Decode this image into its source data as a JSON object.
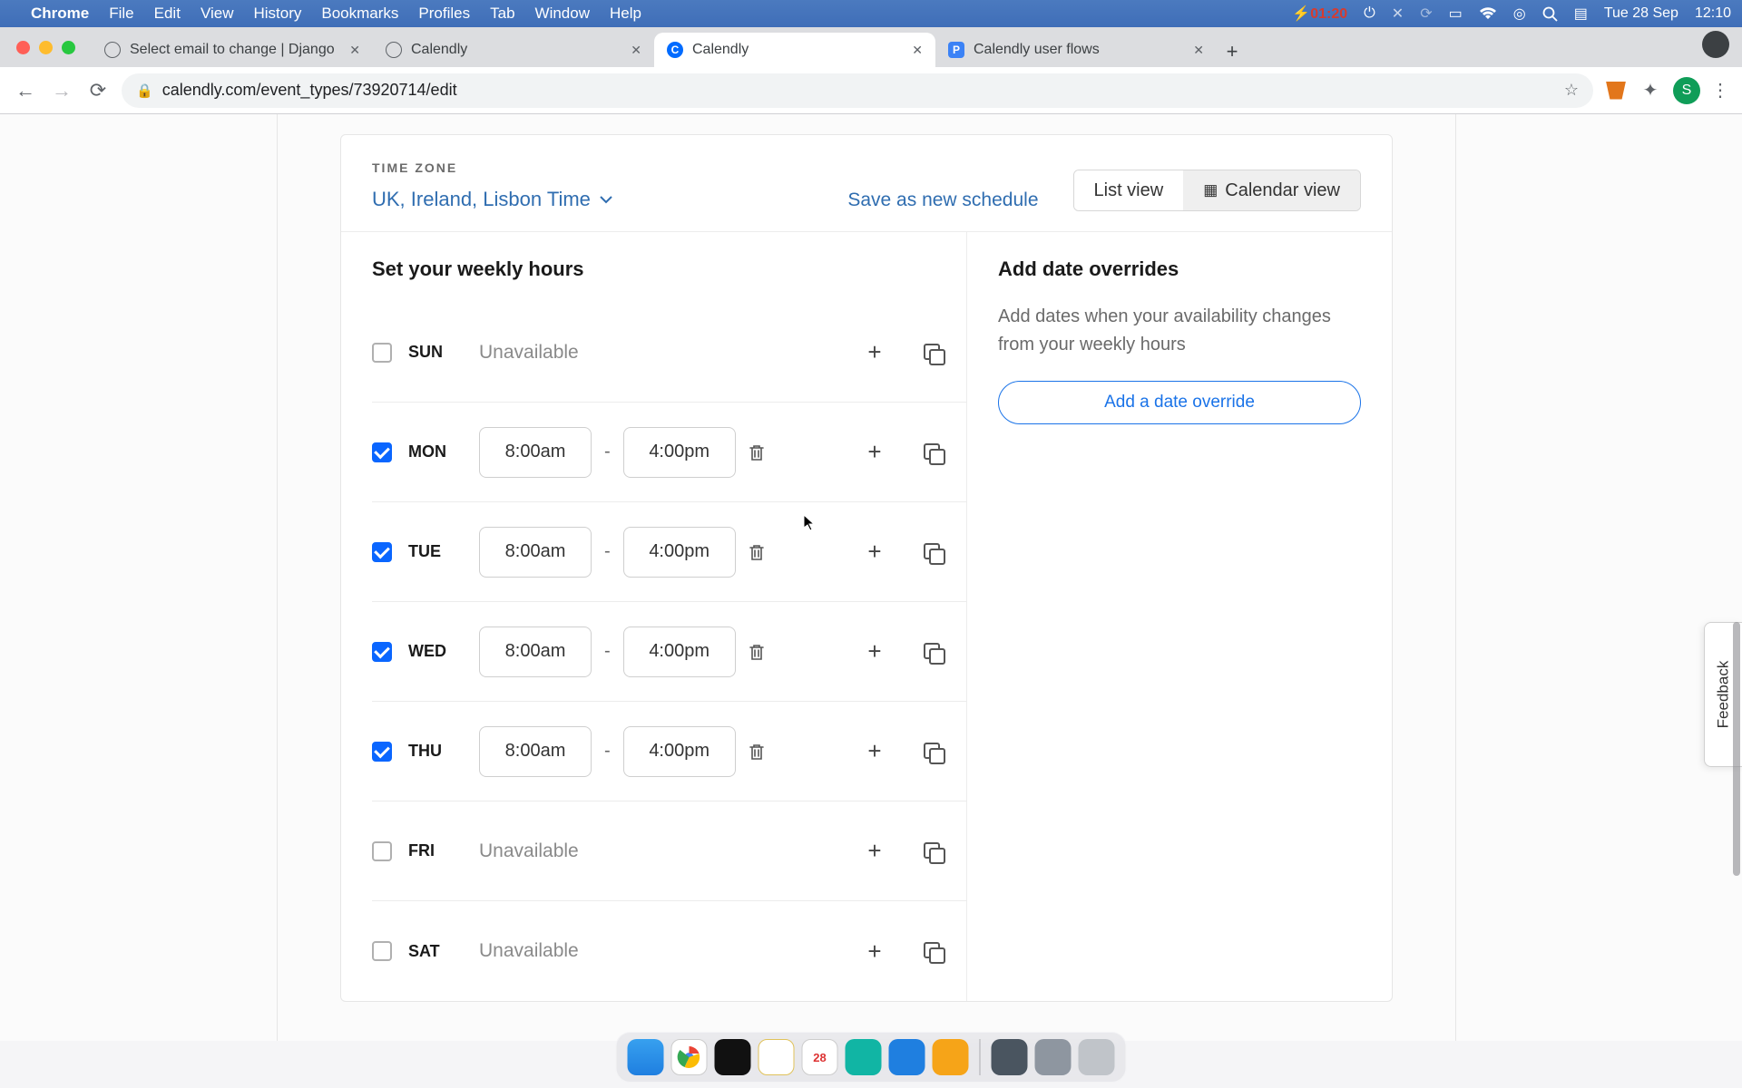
{
  "menubar": {
    "app": "Chrome",
    "items": [
      "File",
      "Edit",
      "View",
      "History",
      "Bookmarks",
      "Profiles",
      "Tab",
      "Window",
      "Help"
    ],
    "battery_time": "01:20",
    "date": "Tue 28 Sep",
    "time": "12:10"
  },
  "tabs": [
    {
      "title": "Select email to change | Django",
      "favicon": "globe"
    },
    {
      "title": "Calendly",
      "favicon": "globe"
    },
    {
      "title": "Calendly",
      "favicon": "calendly",
      "active": true
    },
    {
      "title": "Calendly user flows",
      "favicon": "p"
    }
  ],
  "url": "calendly.com/event_types/73920714/edit",
  "avatar_initial": "S",
  "page": {
    "timezone_label": "TIME ZONE",
    "timezone_value": "UK, Ireland, Lisbon Time",
    "save_as": "Save as new schedule",
    "list_view": "List view",
    "calendar_view": "Calendar view",
    "weekly_title": "Set your weekly hours",
    "overrides_title": "Add date overrides",
    "overrides_text": "Add dates when your availability changes from your weekly hours",
    "override_btn": "Add a date override",
    "unavailable": "Unavailable",
    "days": [
      {
        "name": "SUN",
        "checked": false
      },
      {
        "name": "MON",
        "checked": true,
        "from": "8:00am",
        "to": "4:00pm"
      },
      {
        "name": "TUE",
        "checked": true,
        "from": "8:00am",
        "to": "4:00pm"
      },
      {
        "name": "WED",
        "checked": true,
        "from": "8:00am",
        "to": "4:00pm"
      },
      {
        "name": "THU",
        "checked": true,
        "from": "8:00am",
        "to": "4:00pm"
      },
      {
        "name": "FRI",
        "checked": false
      },
      {
        "name": "SAT",
        "checked": false
      }
    ]
  },
  "feedback": "Feedback",
  "dock_cal_day": "28"
}
